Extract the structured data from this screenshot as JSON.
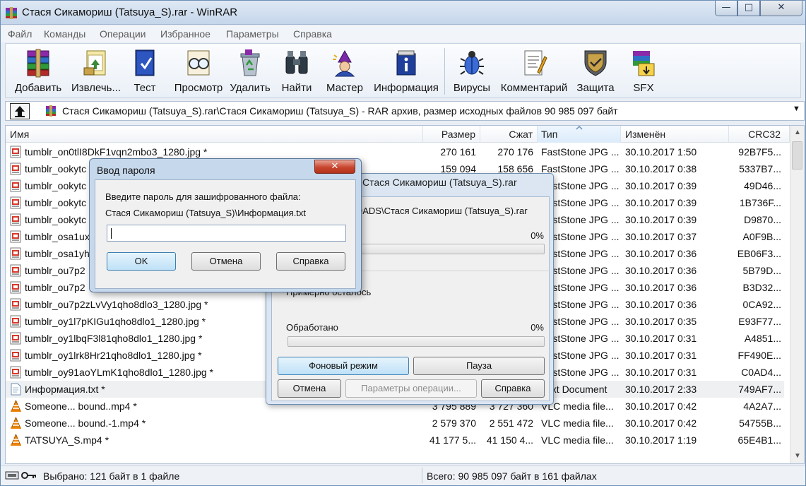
{
  "window": {
    "title": "Стася Сикамориш (Tatsuya_S).rar - WinRAR",
    "minimize_glyph": "—",
    "maximize_glyph": "□",
    "close_glyph": "✕"
  },
  "menu": [
    "Файл",
    "Команды",
    "Операции",
    "Избранное",
    "Параметры",
    "Справка"
  ],
  "toolbar": [
    {
      "label": "Добавить",
      "icon": "add-books-icon"
    },
    {
      "label": "Извлечь...",
      "icon": "extract-folder-icon"
    },
    {
      "label": "Тест",
      "icon": "test-book-icon"
    },
    {
      "label": "Просмотр",
      "icon": "view-glasses-icon"
    },
    {
      "label": "Удалить",
      "icon": "delete-recycle-icon"
    },
    {
      "label": "Найти",
      "icon": "find-binoculars-icon"
    },
    {
      "label": "Мастер",
      "icon": "wizard-icon"
    },
    {
      "label": "Информация",
      "icon": "info-icon"
    },
    {
      "label": "Вирусы",
      "icon": "virus-scan-icon"
    },
    {
      "label": "Комментарий",
      "icon": "comment-icon"
    },
    {
      "label": "Защита",
      "icon": "protect-shield-icon"
    },
    {
      "label": "SFX",
      "icon": "sfx-icon"
    }
  ],
  "path": {
    "text": "Стася Сикамориш (Tatsuya_S).rar\\Стася Сикамориш (Tatsuya_S) - RAR архив, размер исходных файлов 90 985 097 байт"
  },
  "columns": {
    "name": "Имя",
    "size": "Размер",
    "packed": "Сжат",
    "type": "Тип",
    "modified": "Изменён",
    "crc": "CRC32"
  },
  "files": [
    {
      "name": "tumblr_on0tlI8DkF1vqn2mbo3_1280.jpg *",
      "size": "270 161",
      "packed": "270 176",
      "type": "FastStone JPG ...",
      "modified": "30.10.2017 1:50",
      "crc": "92B7F5...",
      "kind": "jpg"
    },
    {
      "name": "tumblr_ookytc",
      "size": "159 094",
      "packed": "158 656",
      "type": "FastStone JPG ...",
      "modified": "30.10.2017 0:38",
      "crc": "5337B7...",
      "kind": "jpg"
    },
    {
      "name": "tumblr_ookytc",
      "size": "",
      "packed": "",
      "type": "FastStone JPG ...",
      "modified": "30.10.2017 0:39",
      "crc": "49D46...",
      "kind": "jpg"
    },
    {
      "name": "tumblr_ookytc",
      "size": "",
      "packed": "",
      "type": "FastStone JPG ...",
      "modified": "30.10.2017 0:39",
      "crc": "1B736F...",
      "kind": "jpg"
    },
    {
      "name": "tumblr_ookytc",
      "size": "",
      "packed": "",
      "type": "FastStone JPG ...",
      "modified": "30.10.2017 0:39",
      "crc": "D9870...",
      "kind": "jpg"
    },
    {
      "name": "tumblr_osa1ux",
      "size": "",
      "packed": "",
      "type": "FastStone JPG ...",
      "modified": "30.10.2017 0:37",
      "crc": "A0F9B...",
      "kind": "jpg"
    },
    {
      "name": "tumblr_osa1yh",
      "size": "",
      "packed": "",
      "type": "FastStone JPG ...",
      "modified": "30.10.2017 0:36",
      "crc": "EB06F3...",
      "kind": "jpg"
    },
    {
      "name": "tumblr_ou7p2",
      "size": "",
      "packed": "",
      "type": "FastStone JPG ...",
      "modified": "30.10.2017 0:36",
      "crc": "5B79D...",
      "kind": "jpg"
    },
    {
      "name": "tumblr_ou7p2",
      "size": "",
      "packed": "",
      "type": "FastStone JPG ...",
      "modified": "30.10.2017 0:36",
      "crc": "B3D32...",
      "kind": "jpg"
    },
    {
      "name": "tumblr_ou7p2zLvVy1qho8dlo3_1280.jpg *",
      "size": "",
      "packed": "",
      "type": "FastStone JPG ...",
      "modified": "30.10.2017 0:36",
      "crc": "0CA92...",
      "kind": "jpg"
    },
    {
      "name": "tumblr_oy1l7pKIGu1qho8dlo1_1280.jpg *",
      "size": "",
      "packed": "",
      "type": "FastStone JPG ...",
      "modified": "30.10.2017 0:35",
      "crc": "E93F77...",
      "kind": "jpg"
    },
    {
      "name": "tumblr_oy1lbqF3l81qho8dlo1_1280.jpg *",
      "size": "",
      "packed": "",
      "type": "FastStone JPG ...",
      "modified": "30.10.2017 0:31",
      "crc": "A4851...",
      "kind": "jpg"
    },
    {
      "name": "tumblr_oy1lrk8Hr21qho8dlo1_1280.jpg *",
      "size": "",
      "packed": "",
      "type": "FastStone JPG ...",
      "modified": "30.10.2017 0:31",
      "crc": "FF490E...",
      "kind": "jpg"
    },
    {
      "name": "tumblr_oy91aoYLmK1qho8dlo1_1280.jpg *",
      "size": "",
      "packed": "",
      "type": "FastStone JPG ...",
      "modified": "30.10.2017 0:31",
      "crc": "C0AD4...",
      "kind": "jpg"
    },
    {
      "name": "Информация.txt *",
      "size": "",
      "packed": "",
      "type": "Text Document",
      "modified": "30.10.2017 2:33",
      "crc": "749AF7...",
      "kind": "txt",
      "selected": true
    },
    {
      "name": "Someone... bound..mp4 *",
      "size": "3 795 889",
      "packed": "3 727 360",
      "type": "VLC media file...",
      "modified": "30.10.2017 0:42",
      "crc": "4A2A7...",
      "kind": "mp4"
    },
    {
      "name": "Someone... bound.-1.mp4 *",
      "size": "2 579 370",
      "packed": "2 551 472",
      "type": "VLC media file...",
      "modified": "30.10.2017 0:42",
      "crc": "54755B...",
      "kind": "mp4"
    },
    {
      "name": "TATSUYA_S.mp4 *",
      "size": "41 177 5...",
      "packed": "41 150 4...",
      "type": "VLC media file...",
      "modified": "30.10.2017 1:19",
      "crc": "65E4B1...",
      "kind": "mp4"
    }
  ],
  "status": {
    "left": "Выбрано: 121 байт в 1 файле",
    "right": "Всего: 90 985 097 байт в 161 файлах"
  },
  "progress_dialog": {
    "title": "Стася Сикамориш (Tatsuya_S).rar",
    "path": "...DADS\\Стася Сикамориш (Tatsuya_S).rar",
    "file_percent": "0%",
    "file_progress": 0,
    "remaining_label": "Примерно осталось",
    "processed_label": "Обработано",
    "processed_percent": "0%",
    "processed_progress": 0,
    "background_button": "Фоновый режим",
    "pause_button": "Пауза",
    "cancel_button": "Отмена",
    "options_button": "Параметры операции...",
    "help_button": "Справка"
  },
  "password_dialog": {
    "title": "Ввод пароля",
    "prompt": "Введите пароль для зашифрованного файла:",
    "file": "Стася Сикамориш (Tatsuya_S)\\Информация.txt",
    "password_value": "",
    "ok_button": "OK",
    "cancel_button": "Отмена",
    "help_button": "Справка"
  },
  "colors": {
    "accent": "#3c7fb1",
    "close_red": "#c8462f",
    "selection": "#eef0f2"
  }
}
